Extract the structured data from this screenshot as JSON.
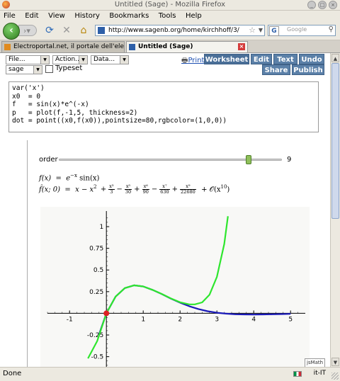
{
  "window": {
    "title": "Untitled (Sage) - Mozilla Firefox"
  },
  "menu": {
    "items": [
      "File",
      "Edit",
      "View",
      "History",
      "Bookmarks",
      "Tools",
      "Help"
    ]
  },
  "nav": {
    "url": "http://www.sagenb.org/home/kirchhoff/3/",
    "search_engine": "G",
    "search_placeholder": "Google"
  },
  "tabs": [
    {
      "label": "Electroportal.net, il portale dell'elettrot...",
      "active": false
    },
    {
      "label": "Untitled (Sage)",
      "active": true
    }
  ],
  "toolbar": {
    "file_label": "File...",
    "action_label": "Action...",
    "data_label": "Data...",
    "system_label": "sage",
    "print_label": "Print",
    "worksheet_label": "Worksheet",
    "edit_label": "Edit",
    "text_label": "Text",
    "undo_label": "Undo",
    "share_label": "Share",
    "publish_label": "Publish",
    "typeset_label": "Typeset"
  },
  "cell": {
    "lines": [
      "var('x')",
      "x0  = 0",
      "f   = sin(x)*e^(-x)",
      "p   = plot(f,-1,5, thickness=2)",
      "dot = point((x0,f(x0)),pointsize=80,rgbcolor=(1,0,0))"
    ]
  },
  "interact": {
    "slider_label": "order",
    "slider_value": "9",
    "slider_fraction": 0.85
  },
  "formula": {
    "f_lhs": "f(x)",
    "f_rhs_a": "e",
    "f_rhs_exp": "−x",
    "f_rhs_b": " sin(x)",
    "taylor_lhs": "f̂(x; 0)",
    "taylor_lead": "x − x",
    "taylor_lead_exp": "2",
    "taylor_tail": "𝒪(x",
    "taylor_tail_exp": "10",
    "taylor_tail_close": ")",
    "fractions": [
      {
        "sign": "+",
        "num": "x³",
        "den": "3"
      },
      {
        "sign": "−",
        "num": "x⁵",
        "den": "30"
      },
      {
        "sign": "+",
        "num": "x⁶",
        "den": "90"
      },
      {
        "sign": "−",
        "num": "x⁷",
        "den": "630"
      },
      {
        "sign": "+",
        "num": "x⁹",
        "den": "22680"
      }
    ]
  },
  "chart_data": {
    "type": "line",
    "xlim": [
      -1.6,
      5.4
    ],
    "ylim": [
      -0.65,
      1.18
    ],
    "x_ticks": [
      -1,
      1,
      2,
      3,
      4,
      5
    ],
    "y_ticks": [
      -0.5,
      -0.25,
      0.25,
      0.5,
      0.75,
      1
    ],
    "x_tick_labels": [
      "-1",
      "1",
      "2",
      "3",
      "4",
      "5"
    ],
    "y_tick_labels": [
      "-0.5",
      "-0.25",
      "0.25",
      "0.5",
      "0.75",
      "1"
    ],
    "series": [
      {
        "color": "#1a1ab8",
        "x": [
          -0.2,
          0,
          0.25,
          0.5,
          0.75,
          1,
          1.25,
          1.5,
          1.75,
          2,
          2.25,
          2.5,
          2.75,
          3,
          3.25,
          3.5,
          3.75,
          4,
          4.25,
          4.5,
          4.75,
          5
        ],
        "y": [
          -0.243,
          0,
          0.193,
          0.291,
          0.323,
          0.31,
          0.271,
          0.223,
          0.17,
          0.123,
          0.082,
          0.049,
          0.024,
          0.007,
          -0.004,
          -0.011,
          -0.013,
          -0.014,
          -0.013,
          -0.011,
          -0.009,
          -0.006
        ]
      },
      {
        "color": "#2ee62e",
        "x": [
          -0.5,
          -0.25,
          0,
          0.25,
          0.5,
          0.75,
          1,
          1.25,
          1.5,
          1.75,
          2,
          2.25,
          2.4,
          2.6,
          2.8,
          3.0,
          3.2,
          3.3
        ],
        "y": [
          -0.52,
          -0.32,
          0,
          0.193,
          0.291,
          0.323,
          0.31,
          0.271,
          0.224,
          0.172,
          0.128,
          0.103,
          0.103,
          0.126,
          0.215,
          0.42,
          0.8,
          1.12
        ]
      }
    ],
    "point": {
      "x": 0,
      "y": 0,
      "color": "#dd2222"
    }
  },
  "status": {
    "text": "Done",
    "locale": "it-IT",
    "jsmath_label": "jsMath"
  }
}
